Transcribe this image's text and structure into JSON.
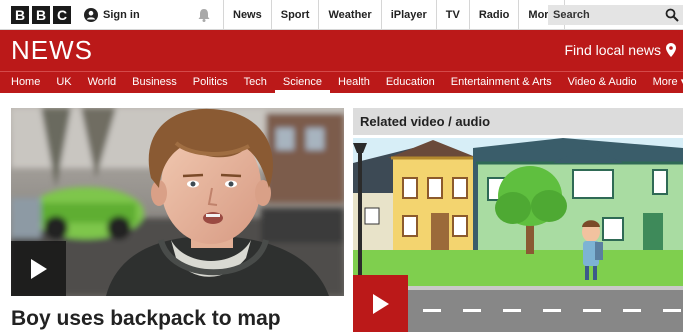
{
  "topbar": {
    "logo_letters": [
      "B",
      "B",
      "C"
    ],
    "signin_label": "Sign in",
    "nav": [
      "News",
      "Sport",
      "Weather",
      "iPlayer",
      "TV",
      "Radio",
      "More"
    ],
    "search_placeholder": "Search"
  },
  "newsbar": {
    "title": "NEWS",
    "find_local": "Find local news"
  },
  "sections": [
    "Home",
    "UK",
    "World",
    "Business",
    "Politics",
    "Tech",
    "Science",
    "Health",
    "Education",
    "Entertainment & Arts",
    "Video & Audio",
    "More ▾"
  ],
  "main": {
    "headline": "Boy uses backpack to map"
  },
  "related": {
    "title": "Related video / audio"
  },
  "colors": {
    "brand_red": "#bb1919",
    "topbar_bg": "#ffffff",
    "search_bg": "#e4e4e4"
  },
  "icons": {
    "signin": "person-icon",
    "notification": "bell-icon",
    "search": "search-icon",
    "location": "pin-icon",
    "play": "play-icon"
  }
}
